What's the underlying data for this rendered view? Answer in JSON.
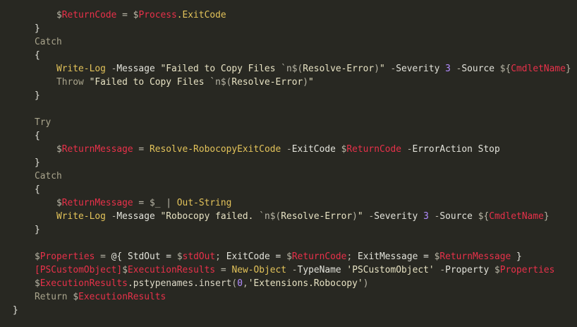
{
  "editor": {
    "lines": [
      {
        "indent": 80,
        "tokens": [
          {
            "t": "$",
            "c": "sigil"
          },
          {
            "t": "ReturnCode",
            "c": "var"
          },
          {
            "t": " = ",
            "c": "op"
          },
          {
            "t": "$",
            "c": "sigil"
          },
          {
            "t": "Process",
            "c": "var"
          },
          {
            "t": ".ExitCode",
            "c": "fn"
          }
        ]
      },
      {
        "indent": 49,
        "tokens": [
          {
            "t": "}",
            "c": "punc"
          }
        ]
      },
      {
        "indent": 49,
        "tokens": [
          {
            "t": "Catch",
            "c": "kw"
          }
        ]
      },
      {
        "indent": 49,
        "tokens": [
          {
            "t": "{",
            "c": "punc"
          }
        ]
      },
      {
        "indent": 80,
        "tokens": [
          {
            "t": "Write-Log",
            "c": "fn"
          },
          {
            "t": " -",
            "c": "op"
          },
          {
            "t": "Message",
            "c": "param"
          },
          {
            "t": " \"Failed to Copy Files ",
            "c": "str"
          },
          {
            "t": "`n",
            "c": "esc"
          },
          {
            "t": "$(",
            "c": "sigil"
          },
          {
            "t": "Resolve-Error",
            "c": "str"
          },
          {
            "t": ")",
            "c": "sigil"
          },
          {
            "t": "\"",
            "c": "str"
          },
          {
            "t": " -",
            "c": "op"
          },
          {
            "t": "Severity",
            "c": "param"
          },
          {
            "t": " 3",
            "c": "num"
          },
          {
            "t": " -",
            "c": "op"
          },
          {
            "t": "Source",
            "c": "param"
          },
          {
            "t": " ${",
            "c": "sigil"
          },
          {
            "t": "CmdletName",
            "c": "var"
          },
          {
            "t": "}",
            "c": "sigil"
          }
        ]
      },
      {
        "indent": 80,
        "tokens": [
          {
            "t": "Throw",
            "c": "kw"
          },
          {
            "t": " \"Failed to Copy Files ",
            "c": "str"
          },
          {
            "t": "`n",
            "c": "esc"
          },
          {
            "t": "$(",
            "c": "sigil"
          },
          {
            "t": "Resolve-Error",
            "c": "str"
          },
          {
            "t": ")",
            "c": "sigil"
          },
          {
            "t": "\"",
            "c": "str"
          }
        ]
      },
      {
        "indent": 49,
        "tokens": [
          {
            "t": "}",
            "c": "punc"
          }
        ]
      },
      {
        "indent": 49,
        "tokens": []
      },
      {
        "indent": 49,
        "tokens": [
          {
            "t": "Try",
            "c": "kw"
          }
        ]
      },
      {
        "indent": 49,
        "tokens": [
          {
            "t": "{",
            "c": "punc"
          }
        ]
      },
      {
        "indent": 80,
        "tokens": [
          {
            "t": "$",
            "c": "sigil"
          },
          {
            "t": "ReturnMessage",
            "c": "var"
          },
          {
            "t": " = ",
            "c": "op"
          },
          {
            "t": "Resolve-RobocopyExitCode",
            "c": "fn"
          },
          {
            "t": " -",
            "c": "op"
          },
          {
            "t": "ExitCode",
            "c": "param"
          },
          {
            "t": " $",
            "c": "sigil"
          },
          {
            "t": "ReturnCode",
            "c": "var"
          },
          {
            "t": " -",
            "c": "op"
          },
          {
            "t": "ErrorAction Stop",
            "c": "param"
          }
        ]
      },
      {
        "indent": 49,
        "tokens": [
          {
            "t": "}",
            "c": "punc"
          }
        ]
      },
      {
        "indent": 49,
        "tokens": [
          {
            "t": "Catch",
            "c": "kw"
          }
        ]
      },
      {
        "indent": 49,
        "tokens": [
          {
            "t": "{",
            "c": "punc"
          }
        ]
      },
      {
        "indent": 80,
        "tokens": [
          {
            "t": "$",
            "c": "sigil"
          },
          {
            "t": "ReturnMessage",
            "c": "var"
          },
          {
            "t": " = ",
            "c": "op"
          },
          {
            "t": "$_",
            "c": "sigil"
          },
          {
            "t": " | ",
            "c": "op"
          },
          {
            "t": "Out-String",
            "c": "fn"
          }
        ]
      },
      {
        "indent": 80,
        "tokens": [
          {
            "t": "Write-Log",
            "c": "fn"
          },
          {
            "t": " -",
            "c": "op"
          },
          {
            "t": "Message",
            "c": "param"
          },
          {
            "t": " \"Robocopy failed. ",
            "c": "str"
          },
          {
            "t": "`n",
            "c": "esc"
          },
          {
            "t": "$(",
            "c": "sigil"
          },
          {
            "t": "Resolve-Error",
            "c": "str"
          },
          {
            "t": ")",
            "c": "sigil"
          },
          {
            "t": "\"",
            "c": "str"
          },
          {
            "t": " -",
            "c": "op"
          },
          {
            "t": "Severity",
            "c": "param"
          },
          {
            "t": " 3",
            "c": "num"
          },
          {
            "t": " -",
            "c": "op"
          },
          {
            "t": "Source",
            "c": "param"
          },
          {
            "t": " ${",
            "c": "sigil"
          },
          {
            "t": "CmdletName",
            "c": "var"
          },
          {
            "t": "}",
            "c": "sigil"
          }
        ]
      },
      {
        "indent": 49,
        "tokens": [
          {
            "t": "}",
            "c": "punc"
          }
        ]
      },
      {
        "indent": 49,
        "tokens": []
      },
      {
        "indent": 49,
        "tokens": [
          {
            "t": "$",
            "c": "sigil"
          },
          {
            "t": "Properties",
            "c": "var"
          },
          {
            "t": " = ",
            "c": "op"
          },
          {
            "t": "@{",
            "c": "punc"
          },
          {
            "t": " StdOut = ",
            "c": "param"
          },
          {
            "t": "$",
            "c": "sigil"
          },
          {
            "t": "stdOut",
            "c": "var"
          },
          {
            "t": "; ",
            "c": "op"
          },
          {
            "t": "ExitCode = ",
            "c": "param"
          },
          {
            "t": "$",
            "c": "sigil"
          },
          {
            "t": "ReturnCode",
            "c": "var"
          },
          {
            "t": "; ",
            "c": "op"
          },
          {
            "t": "ExitMessage = ",
            "c": "param"
          },
          {
            "t": "$",
            "c": "sigil"
          },
          {
            "t": "ReturnMessage",
            "c": "var"
          },
          {
            "t": " }",
            "c": "punc"
          }
        ]
      },
      {
        "indent": 49,
        "tokens": [
          {
            "t": "[PSCustomObject]",
            "c": "type"
          },
          {
            "t": "$",
            "c": "sigil"
          },
          {
            "t": "ExecutionResults",
            "c": "var"
          },
          {
            "t": " = ",
            "c": "op"
          },
          {
            "t": "New-Object",
            "c": "fn"
          },
          {
            "t": " -",
            "c": "op"
          },
          {
            "t": "TypeName",
            "c": "param"
          },
          {
            "t": " 'PSCustomObject'",
            "c": "str"
          },
          {
            "t": " -",
            "c": "op"
          },
          {
            "t": "Property",
            "c": "param"
          },
          {
            "t": " $",
            "c": "sigil"
          },
          {
            "t": "Properties",
            "c": "var"
          }
        ]
      },
      {
        "indent": 49,
        "tokens": [
          {
            "t": "$",
            "c": "sigil"
          },
          {
            "t": "ExecutionResults",
            "c": "var"
          },
          {
            "t": ".pstypenames.insert",
            "c": "method"
          },
          {
            "t": "(",
            "c": "op"
          },
          {
            "t": "0",
            "c": "num"
          },
          {
            "t": ",",
            "c": "op"
          },
          {
            "t": "'Extensions.Robocopy'",
            "c": "str"
          },
          {
            "t": ")",
            "c": "op"
          }
        ]
      },
      {
        "indent": 49,
        "tokens": [
          {
            "t": "Return",
            "c": "kw"
          },
          {
            "t": " $",
            "c": "sigil"
          },
          {
            "t": "ExecutionResults",
            "c": "var"
          }
        ]
      },
      {
        "indent": 18,
        "tokens": [
          {
            "t": "}",
            "c": "punc"
          }
        ]
      }
    ]
  }
}
